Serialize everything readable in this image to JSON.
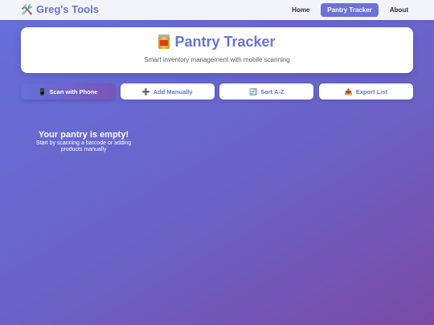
{
  "nav": {
    "brand": "Greg's Tools",
    "brand_icon": "tools-icon",
    "links": [
      {
        "label": "Home",
        "active": false
      },
      {
        "label": "Pantry Tracker",
        "active": true
      },
      {
        "label": "About",
        "active": false
      }
    ]
  },
  "header": {
    "icon": "can-icon",
    "title": "Pantry Tracker",
    "subtitle": "Smart inventory management with mobile scanning"
  },
  "actions": {
    "scan": {
      "label": "Scan with Phone",
      "icon": "phone-icon"
    },
    "add": {
      "label": "Add Manually",
      "icon": "plus-icon"
    },
    "sort": {
      "label": "Sort A-Z",
      "icon": "sort-icon"
    },
    "export": {
      "label": "Export List",
      "icon": "export-icon"
    }
  },
  "empty_state": {
    "title": "Your pantry is empty!",
    "text": "Start by scanning a barcode or adding products manually"
  },
  "colors": {
    "accent": "#6673d4",
    "active_nav": "#6b72d8",
    "background_start": "#6670dc",
    "background_end": "#7a4aa6"
  }
}
